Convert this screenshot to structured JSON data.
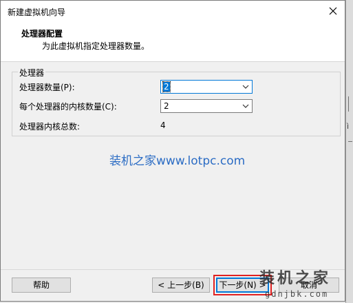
{
  "window": {
    "title": "新建虚拟机向导"
  },
  "header": {
    "heading": "处理器配置",
    "subheading": "为此虚拟机指定处理器数量。"
  },
  "group": {
    "label": "处理器",
    "processor_count": {
      "label": "处理器数量(P):",
      "value": "2"
    },
    "cores_per_processor": {
      "label": "每个处理器的内核数量(C):",
      "value": "2"
    },
    "total_cores": {
      "label": "处理器内核总数:",
      "value": "4"
    }
  },
  "watermark": {
    "text": "装机之家www.lotpc.com"
  },
  "buttons": {
    "help": "帮助",
    "back": "< 上一步(B)",
    "next": "下一步(N) >",
    "cancel": "取消"
  },
  "corner_watermark": {
    "line1": "装机之家",
    "line2": "gdnjbk.com"
  },
  "icons": {
    "close": "close-icon",
    "dropdown": "chevron-down-icon"
  },
  "colors": {
    "focus": "#0078d7",
    "watermark": "#2b6cc4",
    "highlight_box": "#e02020"
  }
}
